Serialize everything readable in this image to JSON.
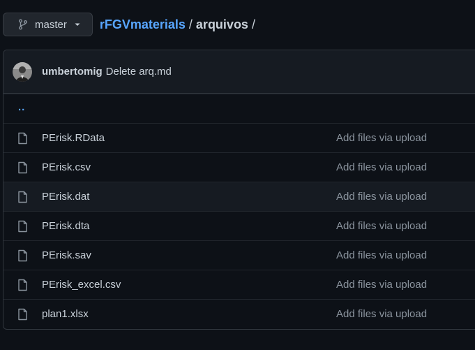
{
  "branch": {
    "label": "master",
    "icon": "git-branch-icon"
  },
  "breadcrumb": {
    "repo": "rFGVmaterials",
    "sep1": "/",
    "dir": "arquivos",
    "sep2": "/"
  },
  "commit": {
    "author": "umbertomig",
    "message": "Delete arq.md"
  },
  "parent_link": "..",
  "files": [
    {
      "name": "PErisk.RData",
      "message": "Add files via upload"
    },
    {
      "name": "PErisk.csv",
      "message": "Add files via upload"
    },
    {
      "name": "PErisk.dat",
      "message": "Add files via upload"
    },
    {
      "name": "PErisk.dta",
      "message": "Add files via upload"
    },
    {
      "name": "PErisk.sav",
      "message": "Add files via upload"
    },
    {
      "name": "PErisk_excel.csv",
      "message": "Add files via upload"
    },
    {
      "name": "plan1.xlsx",
      "message": "Add files via upload"
    }
  ],
  "colors": {
    "link": "#58a6ff",
    "background": "#0d1117",
    "muted": "#8b949e"
  }
}
